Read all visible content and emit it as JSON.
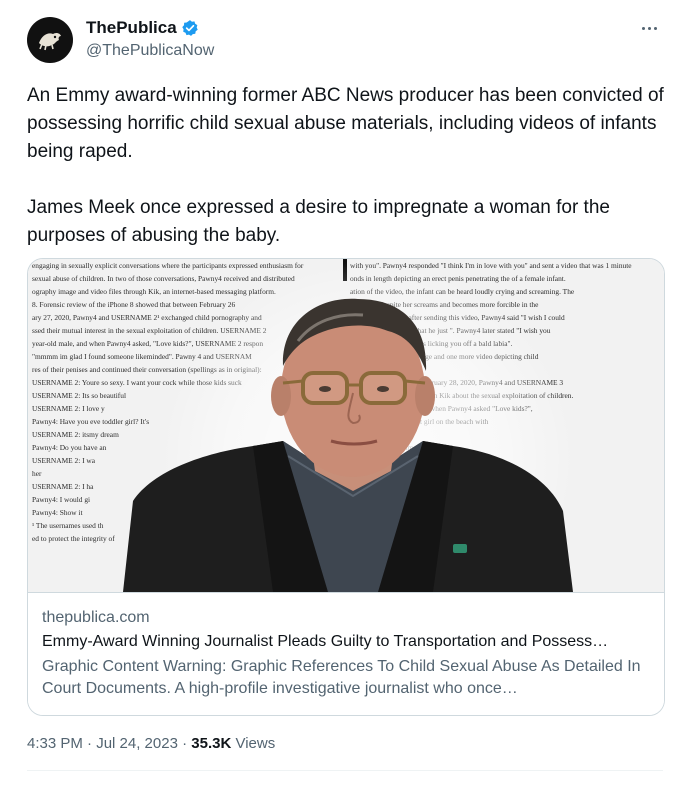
{
  "author": {
    "display_name": "ThePublica",
    "handle": "@ThePublicaNow",
    "verified": true,
    "avatar_icon": "lion-logo"
  },
  "tweet": {
    "paragraphs": [
      "An Emmy award-winning former ABC News producer has been convicted of possessing horrific child sexual abuse materials, including videos of infants being raped.",
      "James Meek once expressed a desire to impregnate a woman for the purposes of abusing the baby."
    ]
  },
  "card": {
    "domain": "thepublica.com",
    "title": "Emmy-Award Winning Journalist Pleads Guilty to Transportation and Possess…",
    "description": "Graphic Content Warning: Graphic References To Child Sexual Abuse As Detailed In Court Documents. A high-profile investigative journalist who once…",
    "image_left_lines": [
      "engaging in sexually explicit conversations where the participants expressed enthusiasm for",
      "sexual abuse of children. In two of those conversations, Pawny4 received and distributed",
      "ography image and video files through Kik, an internet-based messaging platform.",
      "8.      Forensic review of the iPhone 8 showed that between February 26",
      "ary 27, 2020, Pawny4 and USERNAME 2¹ exchanged child pornography and",
      "ssed their mutual interest in the sexual exploitation of children. USERNAME 2",
      "year-old male, and when Pawny4 asked, \"Love kids?\", USERNAME 2 respon",
      "\"mmmm im glad I found someone likeminded\". Pawny 4 and USERNAM",
      "res of their penises and continued their conversation (spellings as in original):",
      "USERNAME 2: Youre so sexy. I want your cock while those kids suck",
      "USERNAME 2: Its so beautiful",
      "USERNAME 2: I love y",
      "Pawny4: Have you eve        toddler girl? It's",
      "USERNAME 2: itsmy dream",
      "Pawny4: Do you have an",
      "USERNAME 2: I wa",
      "her",
      "USERNAME 2: I ha",
      "Pawny4: I would gi",
      "Pawny4: Show it",
      "¹ The usernames used th",
      "ed to protect the integrity of"
    ],
    "image_right_lines": [
      "with you\". Pawny4 responded \"I think I'm in love with you\" and sent a video that was 1 minute",
      "onds in length depicting an erect penis penetrating the        of a female infant.",
      "ation of the video, the infant can be heard loudly crying and screaming. The",
      "the infant despite her screams and becomes more forcible in the",
      "progresses. Shortly after sending this video, Pawny4 said \"I wish I could",
      "ll over that little baby that he just       \". Pawny4 later stated \"I wish you",
      "        hard\" and \"Wishing I was licking you       off a bald labia\".",
      "E 2 at least one more image and one more video depicting child",
      "",
      "February 26, 2020, and February 28, 2020, Pawny4 and USERNAME 3",
      "graphy files and messaged on Kik about the sexual exploitation of children.",
      "as a 22-year-old male, and when Pawny4 asked \"Love kids?\",",
      "image of a prepubescent girl on the beach with",
      "with that gigantic",
      "Pawny4 shared an image of",
      "his fantasies about        the",
      "dren, and impregnating the"
    ]
  },
  "meta": {
    "time": "4:33 PM · Jul 24, 2023 · ",
    "views_count": "35.3K",
    "views_label": " Views"
  }
}
